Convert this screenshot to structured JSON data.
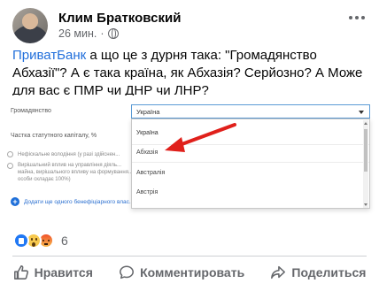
{
  "post": {
    "author": "Клим Братковский",
    "time": "26 мин.",
    "text_link": "ПриватБанк",
    "text_body": " а що це з дурня така: \"Громадянство Абхазії\"? А є така країна, як Абхазія? Серйозно? А Може для вас є ПМР чи ДНР чи ЛНР?"
  },
  "screenshot": {
    "citizenship_label": "Громадянство",
    "selected": "Україна",
    "capital_label": "Частка статутного капіталу, %",
    "options": [
      "Україна",
      "Абхазія",
      "Австралія",
      "Австрія"
    ],
    "radio1": "Нефіскальне володіння (у разі здійснен...",
    "radio2_lines": [
      "Вирішальний вплив на управління діяль...",
      "майна, вирішального впливу на формування...",
      "особи складає 100%)"
    ],
    "add_link": "Додати ще одного бенефіціарного влас..."
  },
  "reactions": {
    "icons": [
      "like-icon",
      "wow-icon",
      "angry-icon"
    ],
    "count": "6"
  },
  "actions": {
    "like": "Нравится",
    "comment": "Комментировать",
    "share": "Поделиться"
  },
  "colors": {
    "link": "#216fdb",
    "arrow": "#e0201b",
    "secondary_text": "#65676b"
  }
}
